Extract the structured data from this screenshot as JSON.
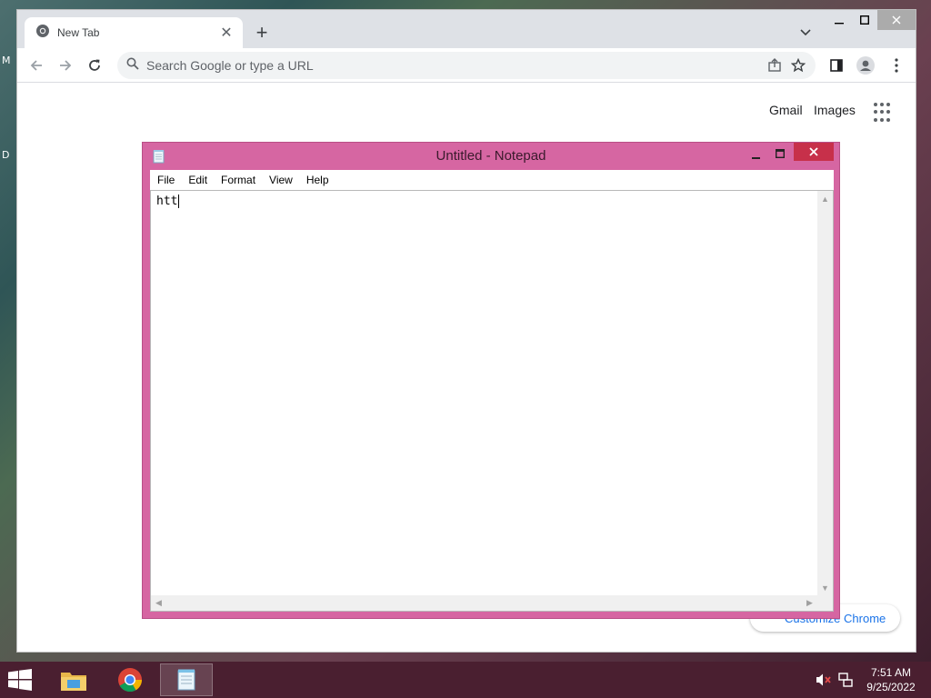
{
  "desktop": {
    "label_top": "M",
    "label_mid": "D"
  },
  "chrome": {
    "tab_title": "New Tab",
    "omnibox_placeholder": "Search Google or type a URL",
    "links": {
      "gmail": "Gmail",
      "images": "Images"
    },
    "customize_label": "Customize Chrome"
  },
  "notepad": {
    "title": "Untitled - Notepad",
    "menu": [
      "File",
      "Edit",
      "Format",
      "View",
      "Help"
    ],
    "content": "htt"
  },
  "taskbar": {
    "time": "7:51 AM",
    "date": "9/25/2022",
    "apps": [
      "file-explorer-icon",
      "chrome-icon",
      "notepad-icon"
    ]
  },
  "colors": {
    "notepad_frame": "#d666a2",
    "close_red": "#c7304a",
    "taskbar": "#4a1f30",
    "chrome_frame": "#dee1e6",
    "link_blue": "#1a73e8"
  }
}
